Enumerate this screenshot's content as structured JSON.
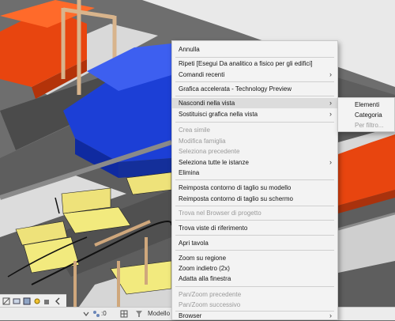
{
  "context_menu": {
    "items": [
      {
        "label": "Annulla"
      },
      {
        "label": "Ripeti [Esegui Da analitico a fisico per gli edifici]"
      },
      {
        "label": "Comandi recenti"
      },
      {
        "label": "Grafica accelerata - Technology Preview"
      },
      {
        "label": "Nascondi nella vista"
      },
      {
        "label": "Sostituisci grafica nella vista"
      },
      {
        "label": "Crea simile"
      },
      {
        "label": "Modifica famiglia"
      },
      {
        "label": "Seleziona precedente"
      },
      {
        "label": "Seleziona tutte le istanze"
      },
      {
        "label": "Elimina"
      },
      {
        "label": "Reimposta contorno di taglio su modello"
      },
      {
        "label": "Reimposta contorno di taglio su schermo"
      },
      {
        "label": "Trova nel Browser di progetto"
      },
      {
        "label": "Trova viste di riferimento"
      },
      {
        "label": "Apri tavola"
      },
      {
        "label": "Zoom su regione"
      },
      {
        "label": "Zoom indietro (2x)"
      },
      {
        "label": "Adatta alla finestra"
      },
      {
        "label": "Pan/Zoom precedente"
      },
      {
        "label": "Pan/Zoom successivo"
      },
      {
        "label": "Browser"
      }
    ],
    "submenu_arrow": "›"
  },
  "submenu": {
    "items": [
      {
        "label": "Elementi"
      },
      {
        "label": "Categoria"
      },
      {
        "label": "Per filtro..."
      }
    ]
  },
  "statusbar": {
    "view_label": "Modello",
    "counter": ":0"
  },
  "colors": {
    "menu_bg": "#f3f3f3",
    "highlight": "#dcdcdc",
    "disabled_text": "#9a9a9a",
    "sofa_orange": "#e8450f",
    "sofa_blue": "#1c3fd6",
    "chair_yellow": "#f2ea7e",
    "wood": "#d8b48c"
  },
  "icons": [
    "scale-icon",
    "detail-level-icon",
    "visual-style-icon",
    "sun-icon",
    "collapse-arrow-icon",
    "worksets-icon",
    "grid-icon"
  ]
}
